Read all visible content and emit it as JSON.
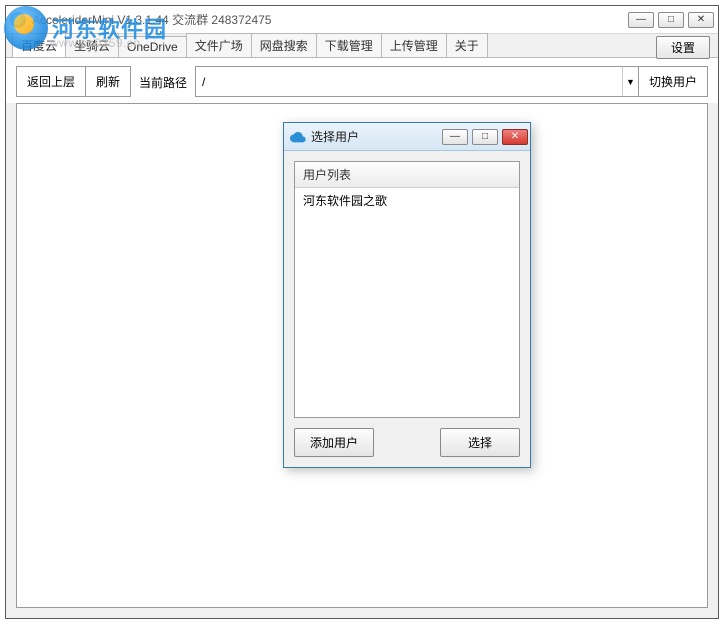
{
  "watermark": {
    "text_cn": "河东软件园",
    "text_en": "www.pc0359.cn"
  },
  "window": {
    "title": "AcceleriderMini V1.3.1.44   交流群 248372475",
    "controls": {
      "min": "—",
      "max": "□",
      "close": "✕"
    }
  },
  "tabs": [
    {
      "label": "百度云"
    },
    {
      "label": "坐骑云"
    },
    {
      "label": "OneDrive"
    },
    {
      "label": "文件广场"
    },
    {
      "label": "网盘搜索"
    },
    {
      "label": "下载管理"
    },
    {
      "label": "上传管理"
    },
    {
      "label": "关于"
    }
  ],
  "settings_label": "设置",
  "toolbar": {
    "back": "返回上层",
    "refresh": "刷新",
    "path_label": "当前路径",
    "path_value": "/",
    "switch_user": "切换用户"
  },
  "dialog": {
    "title": "选择用户",
    "controls": {
      "min": "—",
      "max": "□",
      "close": "✕"
    },
    "list_header": "用户列表",
    "list_items": [
      {
        "label": "河东软件园之歌"
      }
    ],
    "add_user": "添加用户",
    "select": "选择"
  }
}
